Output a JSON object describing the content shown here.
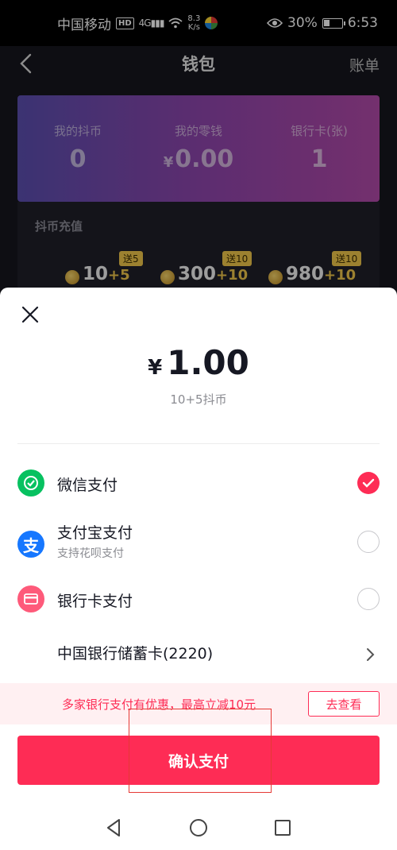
{
  "status_bar": {
    "carrier": "中国移动",
    "hd_badge": "HD",
    "network": "4G",
    "speed_value": "8.3",
    "speed_unit": "K/s",
    "battery": "30%",
    "time": "6:53"
  },
  "nav": {
    "title": "钱包",
    "bill_label": "账单"
  },
  "balance_card": {
    "stats": [
      {
        "label": "我的抖币",
        "value": "0",
        "prefix": ""
      },
      {
        "label": "我的零钱",
        "value": "0.00",
        "prefix": "¥"
      },
      {
        "label": "银行卡(张)",
        "value": "1",
        "prefix": ""
      }
    ]
  },
  "recharge": {
    "title": "抖币充值",
    "packages": [
      {
        "tag": "送5",
        "amount": "10",
        "extra": "+5"
      },
      {
        "tag": "送10",
        "amount": "300",
        "extra": "+10"
      },
      {
        "tag": "送10",
        "amount": "980",
        "extra": "+10"
      }
    ]
  },
  "payment_sheet": {
    "currency": "¥",
    "price": "1.00",
    "price_sub": "10+5抖币",
    "methods": {
      "wechat": {
        "label": "微信支付",
        "selected": true,
        "color": "#07c160"
      },
      "alipay": {
        "label": "支付宝支付",
        "sub": "支持花呗支付",
        "selected": false,
        "color": "#1677ff"
      },
      "bank": {
        "label": "银行卡支付",
        "selected": false,
        "color": "#fe5a7a"
      }
    },
    "bank_card": "中国银行储蓄卡(2220)",
    "promo_text": "多家银行支付有优惠，最高立减10元",
    "promo_button": "去查看",
    "confirm_button": "确认支付"
  },
  "colors": {
    "accent": "#fe2c55",
    "coin_tag": "#f0c64a"
  }
}
